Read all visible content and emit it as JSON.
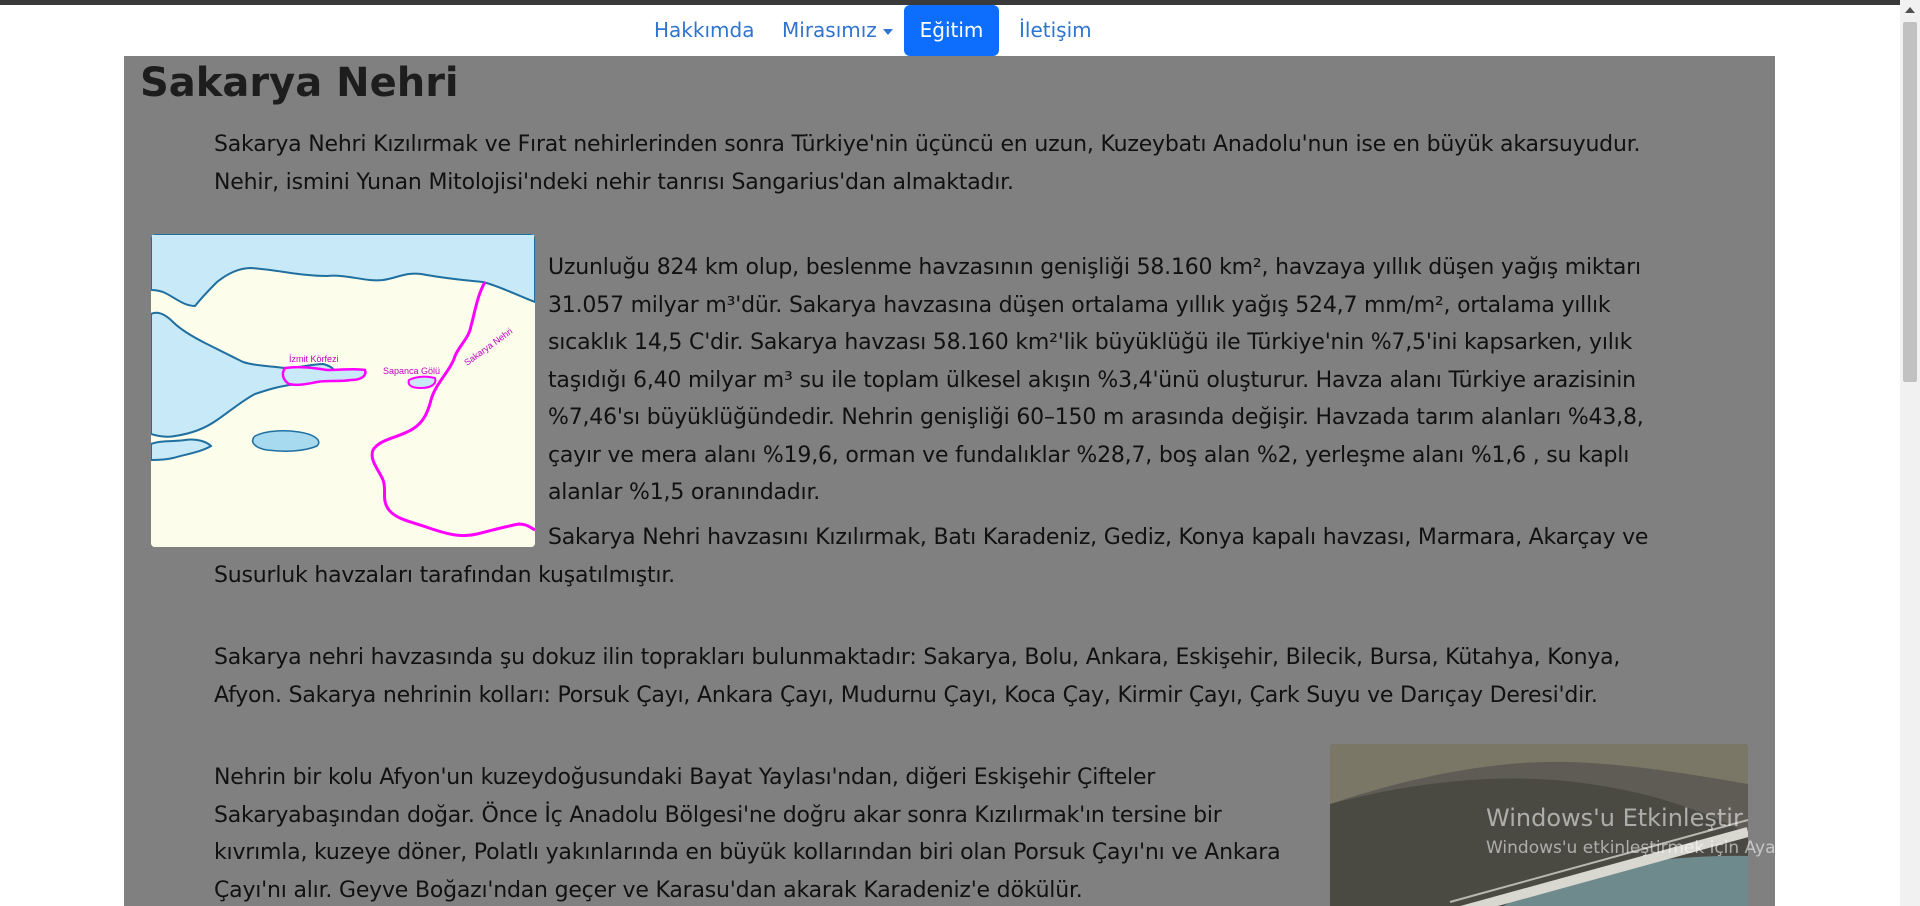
{
  "nav": {
    "items": [
      {
        "label": "Hakkımda"
      },
      {
        "label": "Mirasımız"
      },
      {
        "label": "Eğitim"
      },
      {
        "label": "İletişim"
      }
    ],
    "active_index": 2,
    "colors": {
      "link": "#2f74d0",
      "active_bg": "#0d6efd"
    }
  },
  "article": {
    "title": "Sakarya Nehri",
    "intro": "Sakarya Nehri Kızılırmak ve Fırat nehirlerinden sonra Türkiye'nin üçüncü en uzun, Kuzeybatı Anadolu'nun ise en büyük akarsuyudur. Nehir, ismini Yunan Mitolojisi'ndeki nehir tanrısı Sangarius'dan almaktadır.",
    "p_basin": "Uzunluğu 824 km olup, beslenme havzasının genişliği 58.160 km², havzaya yıllık düşen yağış miktarı 31.057 milyar m³'dür. Sakarya havzasına düşen ortalama yıllık yağış 524,7 mm/m², ortalama yıllık sıcaklık 14,5 C'dir. Sakarya havzası 58.160 km²'lik büyüklüğü ile Türkiye'nin %7,5'ini kapsarken, yılık taşıdığı 6,40 milyar m³ su ile toplam ülkesel akışın %3,4'ünü oluşturur. Havza alanı Türkiye arazisinin %7,46'sı büyüklüğündedir. Nehrin genişliği 60–150 m arasında değişir. Havzada tarım alanları %43,8, çayır ve mera alanı %19,6, orman ve fundalıklar %28,7, boş alan %2, yerleşme alanı %1,6 , su kaplı alanlar %1,5 oranındadır.",
    "p_surround": "Sakarya Nehri havzasını Kızılırmak, Batı Karadeniz, Gediz, Konya kapalı havzası, Marmara, Akarçay ve Susurluk havzaları tarafından kuşatılmıştır.",
    "p_provinces": "Sakarya nehri havzasında şu dokuz ilin toprakları bulunmaktadır: Sakarya, Bolu, Ankara, Eskişehir, Bilecik, Bursa, Kütahya, Konya, Afyon. Sakarya nehrinin kolları: Porsuk Çayı, Ankara Çayı, Mudurnu Çayı, Koca Çay, Kirmir Çayı, Çark Suyu ve Darıçay Deresi'dir.",
    "p_course": "Nehrin bir kolu Afyon'un kuzeydoğusundaki Bayat Yaylası'ndan, diğeri Eskişehir Çifteler Sakaryabaşından doğar. Önce İç Anadolu Bölgesi'ne doğru akar sonra Kızılırmak'ın tersine bir kıvrımla, kuzeye döner, Polatlı yakınlarında en büyük kollarından biri olan Porsuk Çayı'nı ve Ankara Çayı'nı alır. Geyve Boğazı'ndan geçer ve Karasu'dan akarak Karadeniz'e dökülür."
  },
  "map": {
    "labels": {
      "gulf": "İzmit Körfezi",
      "lake": "Sapanca Gölü",
      "river": "Sakarya Nehri"
    },
    "colors": {
      "land": "#fdfdec",
      "sea": "#c8eaf8",
      "coast": "#1f6fa0",
      "river": "#ff00ff",
      "label": "#c000c0"
    }
  },
  "watermark": {
    "line1": "Windows'u Etkinleştir",
    "line2": "Windows'u etkinleştirmek için Ayarlar'a gidin."
  }
}
